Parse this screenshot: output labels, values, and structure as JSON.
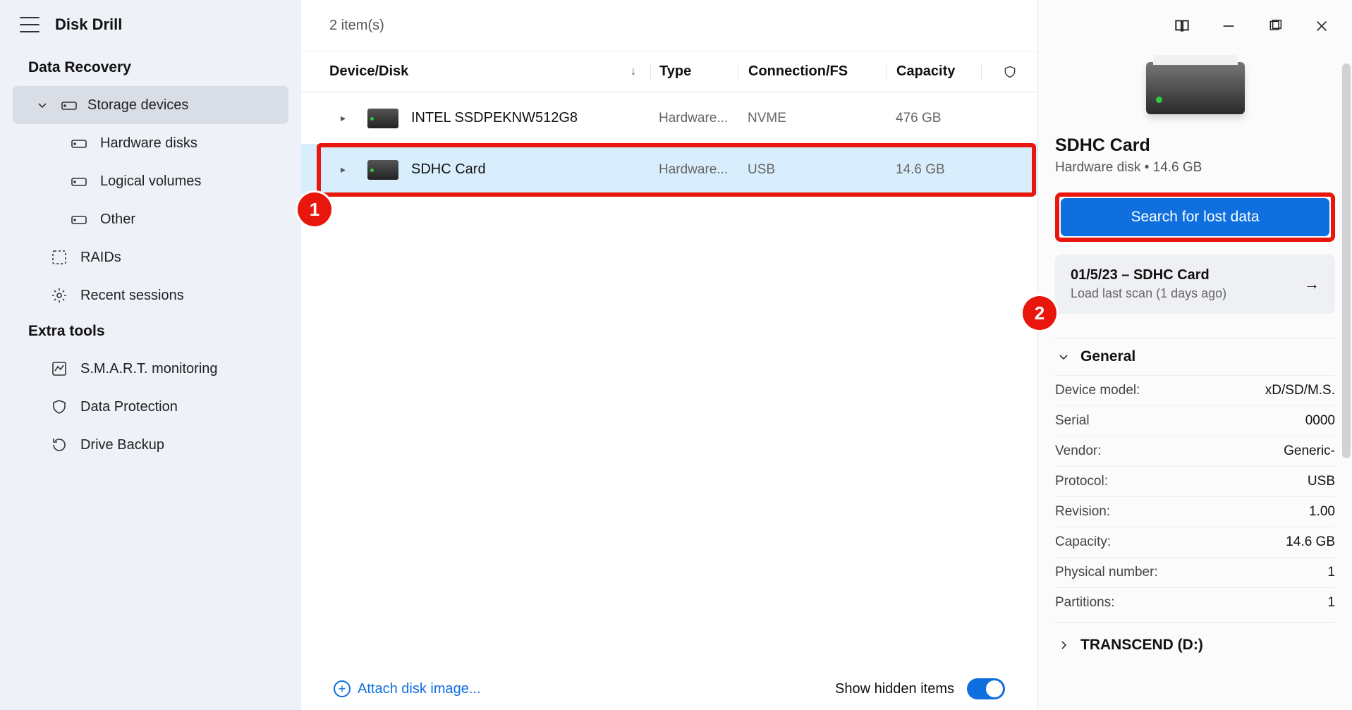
{
  "app_title": "Disk Drill",
  "sidebar": {
    "section_recovery": "Data Recovery",
    "storage_devices": "Storage devices",
    "items": {
      "hardware_disks": "Hardware disks",
      "logical_volumes": "Logical volumes",
      "other": "Other",
      "raids": "RAIDs",
      "recent_sessions": "Recent sessions"
    },
    "section_tools": "Extra tools",
    "tools": {
      "smart": "S.M.A.R.T. monitoring",
      "data_protection": "Data Protection",
      "drive_backup": "Drive Backup"
    }
  },
  "topbar": {
    "count_label": "2 item(s)"
  },
  "columns": {
    "device": "Device/Disk",
    "type": "Type",
    "conn": "Connection/FS",
    "cap": "Capacity"
  },
  "devices": [
    {
      "name": "INTEL SSDPEKNW512G8",
      "type": "Hardware...",
      "conn": "NVME",
      "cap": "476 GB"
    },
    {
      "name": "SDHC Card",
      "type": "Hardware...",
      "conn": "USB",
      "cap": "14.6 GB"
    }
  ],
  "bottom": {
    "attach": "Attach disk image...",
    "show_hidden": "Show hidden items"
  },
  "right": {
    "title": "SDHC Card",
    "subtitle": "Hardware disk • 14.6 GB",
    "search_label": "Search for lost data",
    "session_title": "01/5/23 – SDHC Card",
    "session_sub": "Load last scan (1 days ago)",
    "general_label": "General",
    "kv": [
      {
        "k": "Device model:",
        "v": "xD/SD/M.S."
      },
      {
        "k": "Serial",
        "v": "0000"
      },
      {
        "k": "Vendor:",
        "v": "Generic-"
      },
      {
        "k": "Protocol:",
        "v": "USB"
      },
      {
        "k": "Revision:",
        "v": "1.00"
      },
      {
        "k": "Capacity:",
        "v": "14.6 GB"
      },
      {
        "k": "Physical number:",
        "v": "1"
      },
      {
        "k": "Partitions:",
        "v": "1"
      }
    ],
    "partition_label": "TRANSCEND (D:)"
  },
  "markers": {
    "one": "1",
    "two": "2"
  }
}
